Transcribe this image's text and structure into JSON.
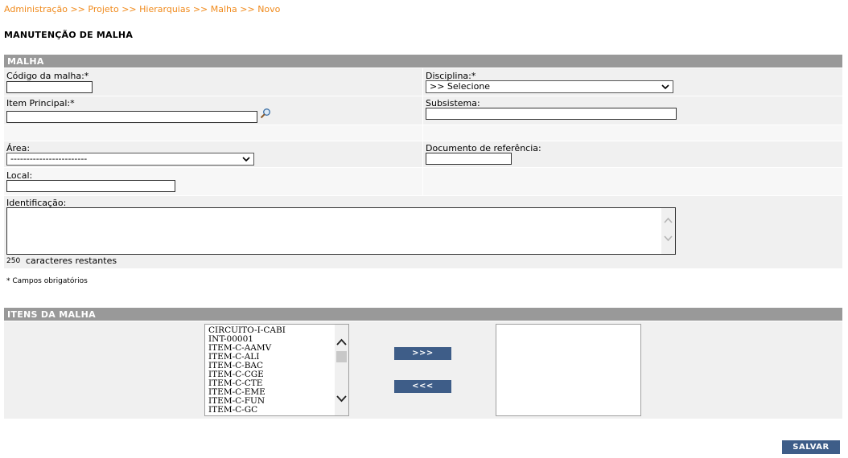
{
  "breadcrumb": {
    "items": [
      "Administração",
      "Projeto",
      "Hierarquias",
      "Malha",
      "Novo"
    ],
    "separator": ">>"
  },
  "page_title": "MANUTENÇÃO DE MALHA",
  "malha_section": {
    "title": "MALHA",
    "codigo_label": "Código da malha:*",
    "codigo_value": "",
    "disciplina_label": "Disciplina:*",
    "disciplina_selected": ">> Selecione",
    "item_principal_label": "Item Principal:*",
    "item_principal_value": "",
    "subsistema_label": "Subsistema:",
    "subsistema_value": "",
    "area_label": "Área:",
    "area_selected": "------------------------",
    "doc_referencia_label": "Documento de referência:",
    "doc_referencia_value": "",
    "local_label": "Local:",
    "local_value": "",
    "identificacao_label": "Identificação:",
    "identificacao_value": "",
    "chars_count": "250",
    "chars_label": "caracteres restantes"
  },
  "required_note": "* Campos obrigatórios",
  "itens_section": {
    "title": "ITENS DA MALHA",
    "available_items": [
      "CIRCUITO-I-CABI",
      "INT-00001",
      "ITEM-C-AAMV",
      "ITEM-C-ALI",
      "ITEM-C-BAC",
      "ITEM-C-CGE",
      "ITEM-C-CTE",
      "ITEM-C-EME",
      "ITEM-C-FUN",
      "ITEM-C-GC"
    ],
    "add_button": ">>>",
    "remove_button": "<<<"
  },
  "save_button": "SALVAR",
  "colors": {
    "breadcrumb": "#f08a1c",
    "section_bar": "#999999",
    "button": "#3e5d88",
    "row_bg": "#f0f0f0"
  }
}
